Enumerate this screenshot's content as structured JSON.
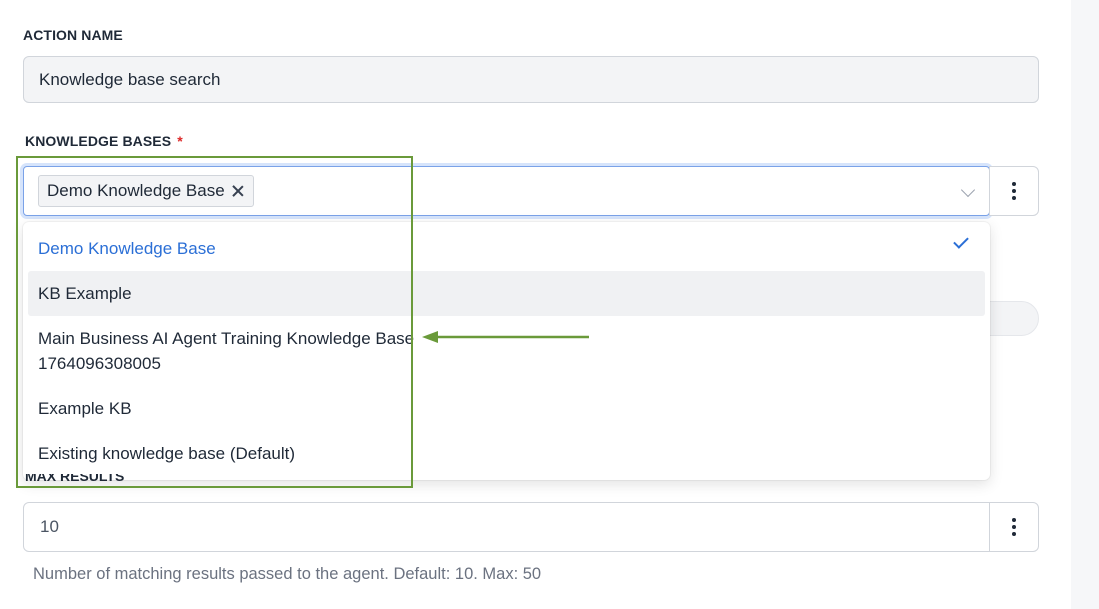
{
  "action_name": {
    "label": "ACTION NAME",
    "value": "Knowledge base search"
  },
  "knowledge_bases": {
    "label": "KNOWLEDGE BASES",
    "required_marker": "*",
    "selected_chips": [
      "Demo Knowledge Base"
    ],
    "options": [
      {
        "label": "Demo Knowledge Base",
        "selected": true
      },
      {
        "label": "KB Example",
        "selected": false,
        "hovered": true
      },
      {
        "label": "Main Business AI Agent Training Knowledge Base 1764096308005",
        "selected": false
      },
      {
        "label": "Example KB",
        "selected": false
      },
      {
        "label": "Existing knowledge base (Default)",
        "selected": false
      }
    ]
  },
  "max_results": {
    "label": "MAX RESULTS",
    "value": "10",
    "help": "Number of matching results passed to the agent. Default: 10. Max: 50"
  },
  "colors": {
    "accent": "#2b6fd6",
    "annotation": "#6a9a3a",
    "required": "#dc2626"
  }
}
